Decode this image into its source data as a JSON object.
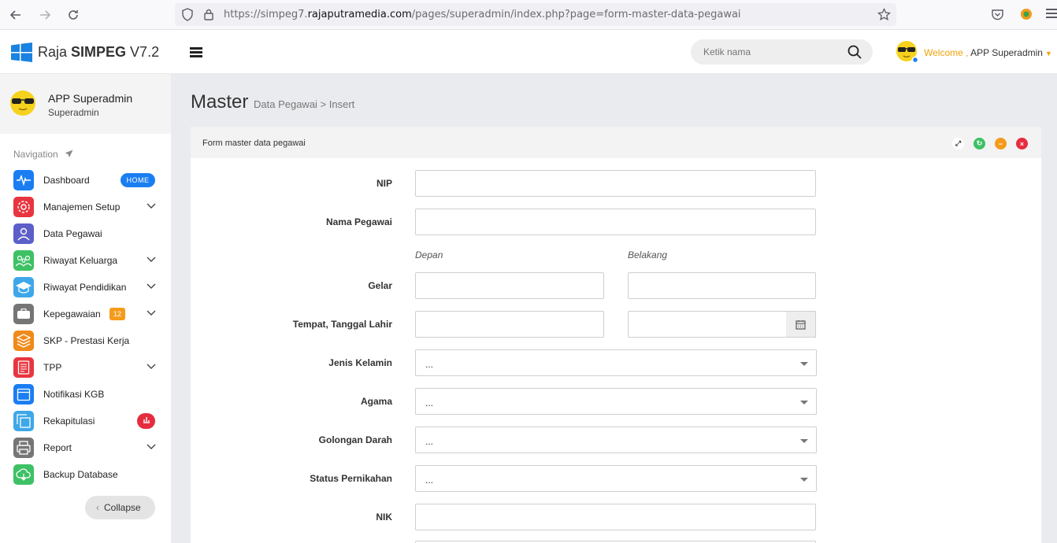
{
  "browser": {
    "url_prefix": "https://simpeg7.",
    "url_domain": "rajaputramedia.com",
    "url_path": "/pages/superadmin/index.php?page=form-master-data-pegawai"
  },
  "header": {
    "brand_light": "Raja ",
    "brand_bold": "SIMPEG",
    "brand_version": " V7.2",
    "search_placeholder": "Ketik nama",
    "welcome": "Welcome ,",
    "user": " APP Superadmin"
  },
  "sidebar": {
    "profile_name": "APP Superadmin",
    "profile_role": "Superadmin",
    "nav_title": "Navigation",
    "items": [
      {
        "label": "Dashboard",
        "icon": "pulse-icon",
        "color": "#1a7ef2",
        "badge": "HOME"
      },
      {
        "label": "Manajemen Setup",
        "icon": "gear-icon",
        "color": "#e8353f"
      },
      {
        "label": "Data Pegawai",
        "icon": "user-icon",
        "color": "#5b5fc7"
      },
      {
        "label": "Riwayat Keluarga",
        "icon": "family-icon",
        "color": "#3ec164"
      },
      {
        "label": "Riwayat Pendidikan",
        "icon": "graduation-cap-icon",
        "color": "#3ea7e8"
      },
      {
        "label": "Kepegawaian",
        "icon": "briefcase-icon",
        "color": "#757575",
        "badge": "12"
      },
      {
        "label": "SKP - Prestasi Kerja",
        "icon": "layers-icon",
        "color": "#f08a1a"
      },
      {
        "label": "TPP",
        "icon": "document-icon",
        "color": "#e8353f"
      },
      {
        "label": "Notifikasi KGB",
        "icon": "calendar-icon",
        "color": "#1a7ef2"
      },
      {
        "label": "Rekapitulasi",
        "icon": "copy-icon",
        "color": "#3ea7e8"
      },
      {
        "label": "Report",
        "icon": "printer-icon",
        "color": "#757575"
      },
      {
        "label": "Backup Database",
        "icon": "cloud-icon",
        "color": "#3ec164"
      }
    ],
    "collapse_label": "Collapse"
  },
  "page": {
    "title": "Master",
    "crumb1": "Data Pegawai",
    "crumb_sep": " > ",
    "crumb2": "Insert"
  },
  "form": {
    "panel_title": "Form master data pegawai",
    "labels": {
      "nip": "NIP",
      "nama": "Nama Pegawai",
      "gelar": "Gelar",
      "ttl": "Tempat, Tanggal Lahir",
      "jk": "Jenis Kelamin",
      "agama": "Agama",
      "goldar": "Golongan Darah",
      "status": "Status Pernikahan",
      "nik": "NIK"
    },
    "sublabel_depan": "Depan",
    "sublabel_belakang": "Belakang",
    "select_default": "..."
  }
}
